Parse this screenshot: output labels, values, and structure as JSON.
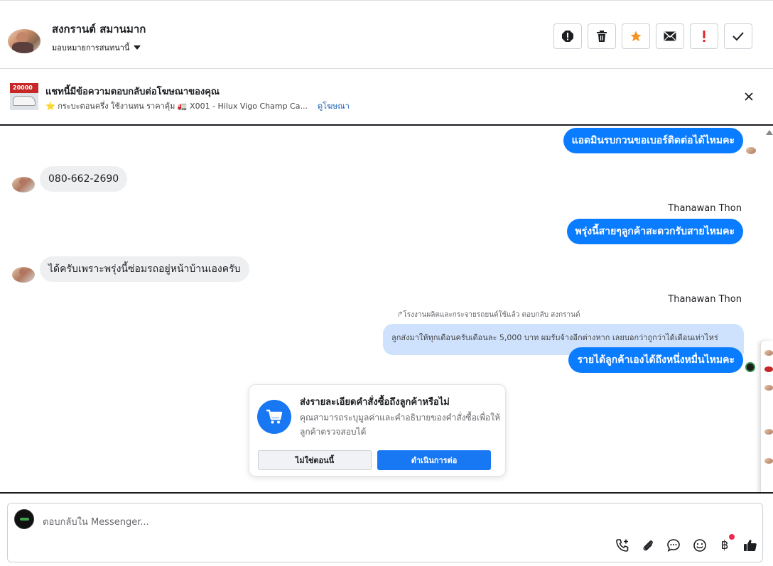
{
  "header": {
    "contact_name": "สงกรานต์ สมานมาก",
    "assign_label": "มอบหมายการสนทนานี้",
    "actions": [
      "report-icon",
      "trash-icon",
      "star-icon",
      "mail-icon",
      "exclamation-icon",
      "check-icon"
    ],
    "colors": {
      "star": "#f7931e",
      "exclamation": "#e02424"
    }
  },
  "ad_banner": {
    "title": "แชทนี้มีข้อความตอบกลับต่อโฆษณาของคุณ",
    "thumb_text": "20000",
    "subtitle": "⭐ กระบะตอนครึ่ง ใช้งานทน ราคาคุ้ม 🚛 X001 - Hilux Vigo Champ Ca...",
    "link": "ดูโฆษณา"
  },
  "messages": [
    {
      "dir": "out",
      "text": "แอดมินรบกวนขอเบอร์ติดต่อได้ไหมคะ"
    },
    {
      "dir": "in",
      "text": "080-662-2690"
    },
    {
      "dir": "out",
      "sender": "Thanawan Thon",
      "text": "พรุ่งนี้สายๆลูกค้าสะดวกรับสายไหมคะ"
    },
    {
      "dir": "in",
      "text": "ได้ครับเพราะพรุ่งนี้ซ่อมรถอยู่หน้าบ้านเองครับ"
    },
    {
      "dir": "out",
      "sender": "Thanawan Thon",
      "reply_label": "โรงงานผลิตและกระจายรถยนต์ใช้แล้ว ตอบกลับ สงกรานต์",
      "quoted": "ลูกส่งมาให้ทุกเดือนครับเดือนละ 5,000 บาท ผมรับจ้างอีกต่างหาก เลยบอกว่าถูกว่าได้เดือนเท่าไหร่",
      "text": "รายได้ลูกค้าเองได้ถึงหนึ่งหมื่นไหมคะ"
    }
  ],
  "order_card": {
    "title": "ส่งรายละเอียดคำสั่งซื้อถึงลูกค้าหรือไม่",
    "description": "คุณสามารถระบุมูลค่าและคำอธิบายของคำสั่งซื้อเพื่อให้ลูกค้าตรวจสอบได้",
    "secondary_button": "ไม่ใช่ตอนนี้",
    "primary_button": "ดำเนินการต่อ",
    "accent": "#1877f2"
  },
  "composer": {
    "placeholder": "ตอบกลับใน Messenger...",
    "tools": [
      "call-add-icon",
      "attach-icon",
      "chat-icon",
      "emoji-icon",
      "baht-icon",
      "like-icon"
    ]
  }
}
